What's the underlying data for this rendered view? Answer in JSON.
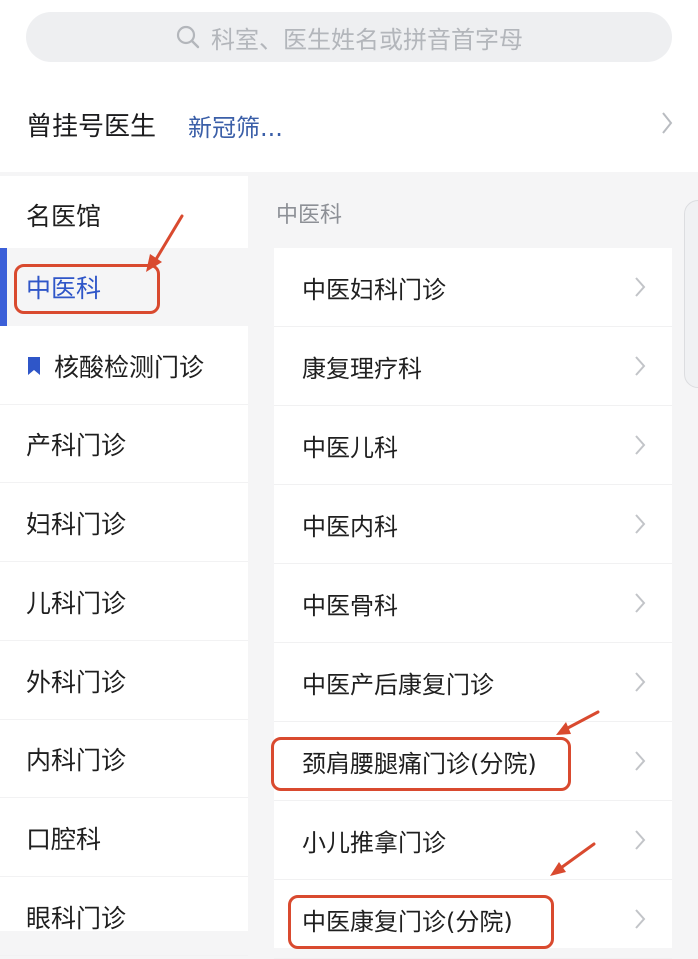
{
  "search": {
    "placeholder": "科室、医生姓名或拼音首字母"
  },
  "history": {
    "title": "曾挂号医生",
    "items": [
      "新冠筛..."
    ]
  },
  "sidebar": {
    "items": [
      {
        "label": "名医馆"
      },
      {
        "label": "中医科",
        "active": true
      },
      {
        "label": "核酸检测门诊",
        "icon": "bookmark-icon"
      },
      {
        "label": "产科门诊"
      },
      {
        "label": "妇科门诊"
      },
      {
        "label": "儿科门诊"
      },
      {
        "label": "外科门诊"
      },
      {
        "label": "内科门诊"
      },
      {
        "label": "口腔科"
      },
      {
        "label": "眼科门诊"
      }
    ]
  },
  "content": {
    "section_title": "中医科",
    "items": [
      {
        "label": "中医妇科门诊"
      },
      {
        "label": "康复理疗科"
      },
      {
        "label": "中医儿科"
      },
      {
        "label": "中医内科"
      },
      {
        "label": "中医骨科"
      },
      {
        "label": "中医产后康复门诊"
      },
      {
        "label": "颈肩腰腿痛门诊(分院)"
      },
      {
        "label": "小儿推拿门诊"
      },
      {
        "label": "中医康复门诊(分院)"
      }
    ]
  },
  "colors": {
    "accent": "#3b5fd8",
    "active_text": "#2f56c8",
    "link": "#3b5fa8",
    "annotation": "#d94a2f"
  }
}
